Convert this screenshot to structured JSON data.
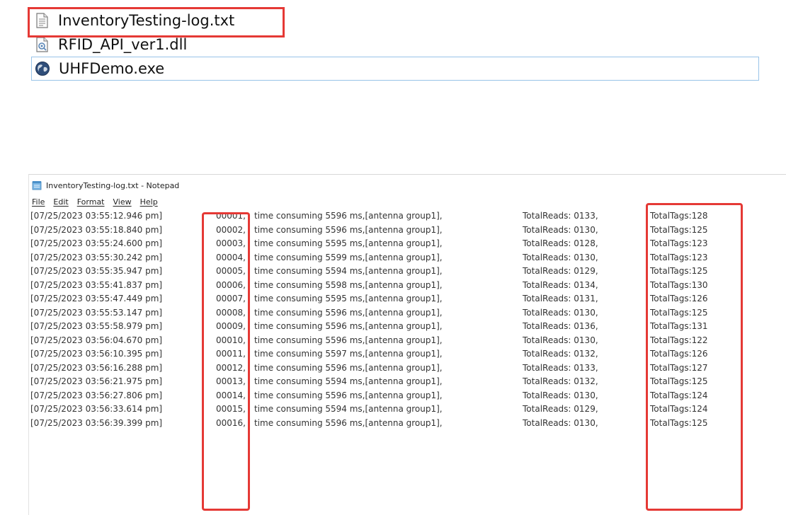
{
  "explorer": {
    "files": [
      {
        "name": "InventoryTesting-log.txt",
        "icon": "text-file-icon",
        "highlighted": true,
        "selected": false
      },
      {
        "name": "RFID_API_ver1.dll",
        "icon": "dll-file-icon",
        "highlighted": false,
        "selected": false
      },
      {
        "name": "UHFDemo.exe",
        "icon": "exe-globe-icon",
        "highlighted": false,
        "selected": true
      }
    ]
  },
  "notepad": {
    "title": "InventoryTesting-log.txt - Notepad",
    "menu": [
      "File",
      "Edit",
      "Format",
      "View",
      "Help"
    ],
    "log_lines": [
      {
        "timestamp": "[07/25/2023 03:55:12.946 pm]",
        "seq": "00001,",
        "message": "time consuming 5596 ms,[antenna group1],",
        "reads": "TotalReads: 0133,",
        "tags": "TotalTags:128"
      },
      {
        "timestamp": "[07/25/2023 03:55:18.840 pm]",
        "seq": "00002,",
        "message": "time consuming 5596 ms,[antenna group1],",
        "reads": "TotalReads: 0130,",
        "tags": "TotalTags:125"
      },
      {
        "timestamp": "[07/25/2023 03:55:24.600 pm]",
        "seq": "00003,",
        "message": "time consuming 5595 ms,[antenna group1],",
        "reads": "TotalReads: 0128,",
        "tags": "TotalTags:123"
      },
      {
        "timestamp": "[07/25/2023 03:55:30.242 pm]",
        "seq": "00004,",
        "message": "time consuming 5599 ms,[antenna group1],",
        "reads": "TotalReads: 0130,",
        "tags": "TotalTags:123"
      },
      {
        "timestamp": "[07/25/2023 03:55:35.947 pm]",
        "seq": "00005,",
        "message": "time consuming 5594 ms,[antenna group1],",
        "reads": "TotalReads: 0129,",
        "tags": "TotalTags:125"
      },
      {
        "timestamp": "[07/25/2023 03:55:41.837 pm]",
        "seq": "00006,",
        "message": "time consuming 5598 ms,[antenna group1],",
        "reads": "TotalReads: 0134,",
        "tags": "TotalTags:130"
      },
      {
        "timestamp": "[07/25/2023 03:55:47.449 pm]",
        "seq": "00007,",
        "message": "time consuming 5595 ms,[antenna group1],",
        "reads": "TotalReads: 0131,",
        "tags": "TotalTags:126"
      },
      {
        "timestamp": "[07/25/2023 03:55:53.147 pm]",
        "seq": "00008,",
        "message": "time consuming 5596 ms,[antenna group1],",
        "reads": "TotalReads: 0130,",
        "tags": "TotalTags:125"
      },
      {
        "timestamp": "[07/25/2023 03:55:58.979 pm]",
        "seq": "00009,",
        "message": "time consuming 5596 ms,[antenna group1],",
        "reads": "TotalReads: 0136,",
        "tags": "TotalTags:131"
      },
      {
        "timestamp": "[07/25/2023 03:56:04.670 pm]",
        "seq": "00010,",
        "message": "time consuming 5596 ms,[antenna group1],",
        "reads": "TotalReads: 0130,",
        "tags": "TotalTags:122"
      },
      {
        "timestamp": "[07/25/2023 03:56:10.395 pm]",
        "seq": "00011,",
        "message": "time consuming 5597 ms,[antenna group1],",
        "reads": "TotalReads: 0132,",
        "tags": "TotalTags:126"
      },
      {
        "timestamp": "[07/25/2023 03:56:16.288 pm]",
        "seq": "00012,",
        "message": "time consuming 5596 ms,[antenna group1],",
        "reads": "TotalReads: 0133,",
        "tags": "TotalTags:127"
      },
      {
        "timestamp": "[07/25/2023 03:56:21.975 pm]",
        "seq": "00013,",
        "message": "time consuming 5594 ms,[antenna group1],",
        "reads": "TotalReads: 0132,",
        "tags": "TotalTags:125"
      },
      {
        "timestamp": "[07/25/2023 03:56:27.806 pm]",
        "seq": "00014,",
        "message": "time consuming 5596 ms,[antenna group1],",
        "reads": "TotalReads: 0130,",
        "tags": "TotalTags:124"
      },
      {
        "timestamp": "[07/25/2023 03:56:33.614 pm]",
        "seq": "00015,",
        "message": "time consuming 5594 ms,[antenna group1],",
        "reads": "TotalReads: 0129,",
        "tags": "TotalTags:124"
      },
      {
        "timestamp": "[07/25/2023 03:56:39.399 pm]",
        "seq": "00016,",
        "message": "time consuming 5596 ms,[antenna group1],",
        "reads": "TotalReads: 0130,",
        "tags": "TotalTags:125"
      }
    ]
  },
  "colors": {
    "highlight_box": "#e53935",
    "selection_border": "#98c3e8"
  }
}
